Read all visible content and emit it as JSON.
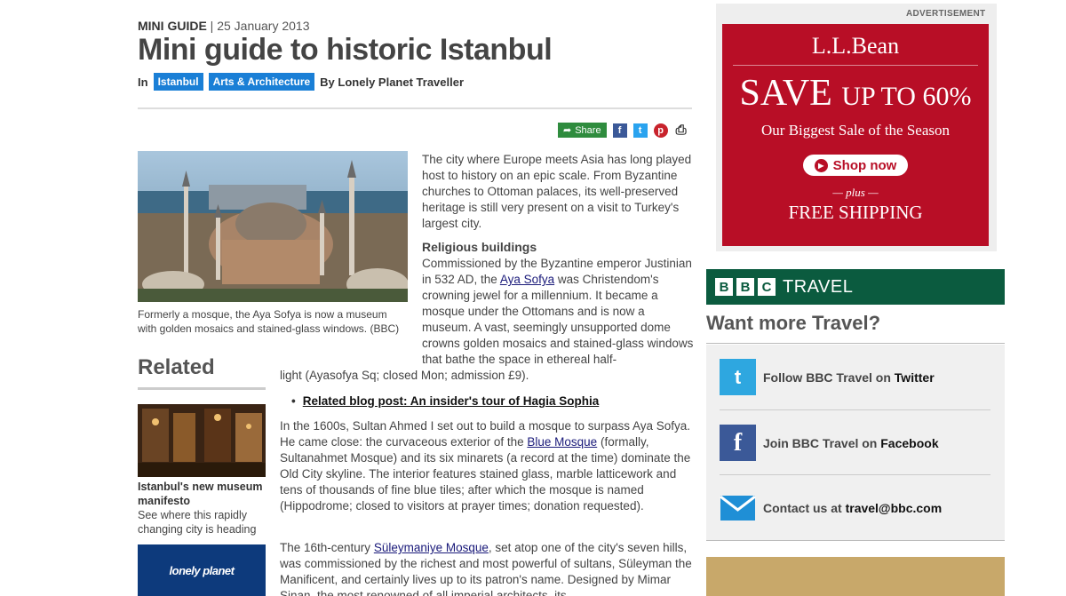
{
  "article": {
    "kicker_label": "MINI GUIDE",
    "kicker_date": "| 25 January 2013",
    "title": "Mini guide to historic Istanbul",
    "byline_in": "In",
    "tags": [
      "Istanbul",
      "Arts & Architecture"
    ],
    "byline_by": "By Lonely Planet Traveller",
    "share_label": "Share",
    "caption": "Formerly a mosque, the Aya Sofya is now a museum with golden mosaics and stained-glass windows. (BBC)",
    "intro": "The city where Europe meets Asia has long played host to history on an epic scale. From Byzantine churches to Ottoman palaces, its well-preserved heritage is still very present on a visit to Turkey's largest city.",
    "section_heading": "Religious buildings",
    "p2_before": "Commissioned by the Byzantine emperor Justinian in 532 AD, the ",
    "p2_link": "Aya Sofya",
    "p2_after": " was Christendom's crowning jewel for a millennium. It became a mosque under the Ottomans and is now a museum. A vast, seemingly unsupported dome crowns golden mosaics and stained-glass windows that bathe the space in ethereal half-",
    "p2_cont": "light (Ayasofya Sq; closed Mon; admission £9).",
    "related_link": "Related blog post: An insider's tour of Hagia Sophia",
    "p3_before": "In the 1600s, Sultan Ahmed I set out to build a mosque to surpass Aya Sofya. He came close: the curvaceous exterior of the ",
    "p3_link": "Blue Mosque",
    "p3_after": " (formally, Sultanahmet Mosque) and its six minarets (a record at the time) dominate the Old City skyline. The interior features stained glass, marble latticework and tens of thousands of fine blue tiles; after which the mosque is named (Hippodrome; closed to visitors at prayer times; donation requested).",
    "p4_before": "The 16th-century ",
    "p4_link": "Süleymaniye Mosque",
    "p4_after": ", set atop one of the city's seven hills, was commissioned by the richest and most powerful of sultans, Süleyman the Manificent, and certainly lives up to its patron's name. Designed by Mimar Sinan, the most renowned of all imperial architects, its"
  },
  "related": {
    "heading": "Related",
    "item_title": "Istanbul's new museum manifesto",
    "item_desc": "See where this rapidly changing city is heading",
    "logo_text": "lonely planet"
  },
  "ad": {
    "label": "ADVERTISEMENT",
    "brand": "L.L.Bean",
    "save": "SAVE",
    "upto": "UP TO 60%",
    "sub": "Our Biggest Sale of the Season",
    "shop": "Shop now",
    "plus": "— plus —",
    "free": "FREE SHIPPING"
  },
  "bbc": {
    "letters": [
      "B",
      "B",
      "C"
    ],
    "travel": "TRAVEL",
    "want": "Want more Travel?",
    "twitter_pre": "Follow BBC Travel on ",
    "twitter_hl": "Twitter",
    "facebook_pre": "Join BBC Travel on ",
    "facebook_hl": "Facebook",
    "contact_pre": "Contact us at ",
    "contact_hl": "travel@bbc.com"
  },
  "icons": [
    "share-icon",
    "facebook-icon",
    "twitter-icon",
    "pinterest-icon",
    "print-icon",
    "play-icon",
    "twitter-bird-icon",
    "facebook-f-icon",
    "mail-icon"
  ],
  "colors": {
    "tag_blue": "#1a7fd6",
    "share_green": "#2f8c3e",
    "ad_red": "#b80e26",
    "bbc_green": "#0b5b3f"
  }
}
